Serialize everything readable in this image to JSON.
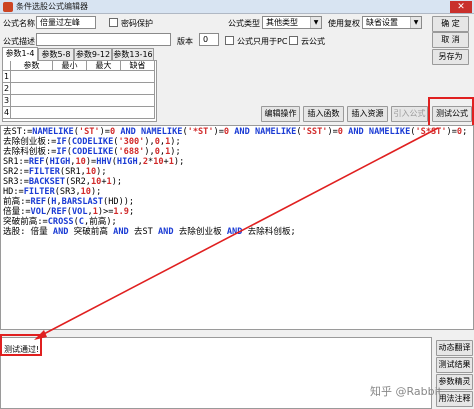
{
  "window": {
    "title": "条件选股公式编辑器",
    "close_glyph": "✕"
  },
  "form": {
    "name_label": "公式名称",
    "name_value": "倍量过左峰",
    "password_label": "密码保护",
    "desc_label": "公式描述",
    "type_label": "公式类型",
    "type_value": "其他类型",
    "rights_label": "使用复权",
    "rights_value": "缺省设置",
    "version_label": "版本",
    "version_value": "0",
    "pc_only_label": "公式只用于PC",
    "cloud_label": "云公式"
  },
  "buttons": {
    "confirm": "确  定",
    "cancel": "取  消",
    "save_as": "另存为",
    "edit_ops": "编辑操作",
    "insert_func": "插入函数",
    "insert_resource": "插入资源",
    "import_formula": "引入公式",
    "test_formula": "测试公式"
  },
  "tabs": [
    "参数1-4",
    "参数5-8",
    "参数9-12",
    "参数13-16"
  ],
  "param_grid": {
    "headers": [
      "参数",
      "最小",
      "最大",
      "缺省"
    ],
    "row_numbers": [
      "1",
      "2",
      "3",
      "4"
    ]
  },
  "code": {
    "l1": [
      [
        "t",
        "去ST:="
      ],
      [
        "k",
        "NAMELIKE"
      ],
      [
        "t",
        "("
      ],
      [
        "n",
        "'ST'"
      ],
      [
        "t",
        ")="
      ],
      [
        "n",
        "0"
      ],
      [
        "t",
        " "
      ],
      [
        "k",
        "AND"
      ],
      [
        "t",
        " "
      ],
      [
        "k",
        "NAMELIKE"
      ],
      [
        "t",
        "("
      ],
      [
        "n",
        "'*ST'"
      ],
      [
        "t",
        ")="
      ],
      [
        "n",
        "0"
      ],
      [
        "t",
        " "
      ],
      [
        "k",
        "AND"
      ],
      [
        "t",
        " "
      ],
      [
        "k",
        "NAMELIKE"
      ],
      [
        "t",
        "("
      ],
      [
        "n",
        "'SST'"
      ],
      [
        "t",
        ")="
      ],
      [
        "n",
        "0"
      ],
      [
        "t",
        " "
      ],
      [
        "k",
        "AND"
      ],
      [
        "t",
        " "
      ],
      [
        "k",
        "NAMELIKE"
      ],
      [
        "t",
        "("
      ],
      [
        "n",
        "'S*ST'"
      ],
      [
        "t",
        ")="
      ],
      [
        "n",
        "0"
      ],
      [
        "t",
        ";"
      ]
    ],
    "l2": [
      [
        "t",
        "去除创业板:="
      ],
      [
        "k",
        "IF"
      ],
      [
        "t",
        "("
      ],
      [
        "k",
        "CODELIKE"
      ],
      [
        "t",
        "("
      ],
      [
        "n",
        "'300'"
      ],
      [
        "t",
        "),"
      ],
      [
        "n",
        "0"
      ],
      [
        "t",
        ","
      ],
      [
        "n",
        "1"
      ],
      [
        "t",
        ");"
      ]
    ],
    "l3": [
      [
        "t",
        "去除科创板:="
      ],
      [
        "k",
        "IF"
      ],
      [
        "t",
        "("
      ],
      [
        "k",
        "CODELIKE"
      ],
      [
        "t",
        "("
      ],
      [
        "n",
        "'688'"
      ],
      [
        "t",
        "),"
      ],
      [
        "n",
        "0"
      ],
      [
        "t",
        ","
      ],
      [
        "n",
        "1"
      ],
      [
        "t",
        ");"
      ]
    ],
    "l4": [
      [
        "t",
        "SR1:="
      ],
      [
        "k",
        "REF"
      ],
      [
        "t",
        "("
      ],
      [
        "k",
        "HIGH"
      ],
      [
        "t",
        ","
      ],
      [
        "n",
        "10"
      ],
      [
        "t",
        ")="
      ],
      [
        "k",
        "HHV"
      ],
      [
        "t",
        "("
      ],
      [
        "k",
        "HIGH"
      ],
      [
        "t",
        ","
      ],
      [
        "n",
        "2"
      ],
      [
        "t",
        "*"
      ],
      [
        "n",
        "10"
      ],
      [
        "t",
        "+"
      ],
      [
        "n",
        "1"
      ],
      [
        "t",
        ");"
      ]
    ],
    "l5": [
      [
        "t",
        "SR2:="
      ],
      [
        "k",
        "FILTER"
      ],
      [
        "t",
        "(SR1,"
      ],
      [
        "n",
        "10"
      ],
      [
        "t",
        ");"
      ]
    ],
    "l6": [
      [
        "t",
        "SR3:="
      ],
      [
        "k",
        "BACKSET"
      ],
      [
        "t",
        "(SR2,"
      ],
      [
        "n",
        "10"
      ],
      [
        "t",
        "+"
      ],
      [
        "n",
        "1"
      ],
      [
        "t",
        ");"
      ]
    ],
    "l7": [
      [
        "t",
        "HD:="
      ],
      [
        "k",
        "FILTER"
      ],
      [
        "t",
        "(SR3,"
      ],
      [
        "n",
        "10"
      ],
      [
        "t",
        ");"
      ]
    ],
    "l8": [
      [
        "t",
        "前高:="
      ],
      [
        "k",
        "REF"
      ],
      [
        "t",
        "("
      ],
      [
        "k",
        "H"
      ],
      [
        "t",
        ","
      ],
      [
        "k",
        "BARSLAST"
      ],
      [
        "t",
        "(HD));"
      ]
    ],
    "l9": [
      [
        "t",
        "倍量:="
      ],
      [
        "k",
        "VOL"
      ],
      [
        "t",
        "/"
      ],
      [
        "k",
        "REF"
      ],
      [
        "t",
        "("
      ],
      [
        "k",
        "VOL"
      ],
      [
        "t",
        ","
      ],
      [
        "n",
        "1"
      ],
      [
        "t",
        ")>="
      ],
      [
        "n",
        "1.9"
      ],
      [
        "t",
        ";"
      ]
    ],
    "l10": [
      [
        "t",
        "突破前高:="
      ],
      [
        "k",
        "CROSS"
      ],
      [
        "t",
        "("
      ],
      [
        "k",
        "C"
      ],
      [
        "t",
        ",前高);"
      ]
    ],
    "l11": [
      [
        "t",
        "选股: 倍量 "
      ],
      [
        "k",
        "AND"
      ],
      [
        "t",
        " 突破前高 "
      ],
      [
        "k",
        "AND"
      ],
      [
        "t",
        " 去ST "
      ],
      [
        "k",
        "AND"
      ],
      [
        "t",
        " 去除创业板 "
      ],
      [
        "k",
        "AND"
      ],
      [
        "t",
        " 去除科创板;"
      ]
    ]
  },
  "output": {
    "message": "测试通过!"
  },
  "side_buttons": [
    "动态翻译",
    "测试结果",
    "参数精灵",
    "用法注释"
  ],
  "watermark": "知乎 @Rabbit",
  "colors": {
    "keyword": "#1a3bd4",
    "number": "#d12a2a",
    "highlight": "#e02020"
  }
}
